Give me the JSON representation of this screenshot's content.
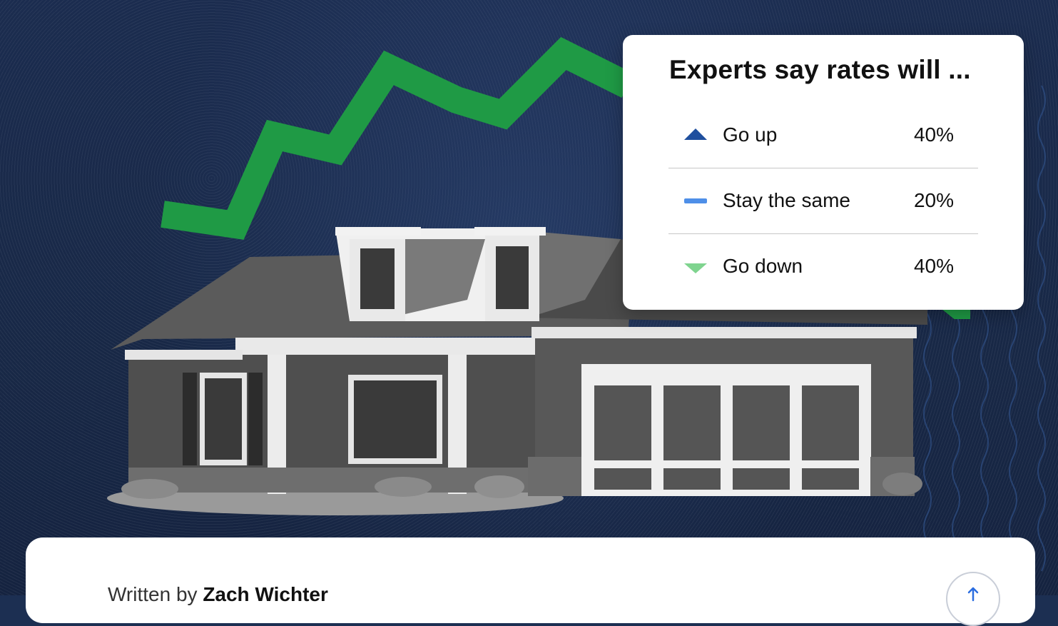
{
  "hero_image": {
    "description_icon": "house-photo-with-rising-chart"
  },
  "poll": {
    "title": "Experts say rates will ...",
    "options": [
      {
        "icon": "triangle-up-icon",
        "label": "Go up",
        "percent": "40%",
        "color": "#1f4f9e"
      },
      {
        "icon": "dash-icon",
        "label": "Stay the same",
        "percent": "20%",
        "color": "#4e8fe8"
      },
      {
        "icon": "triangle-down-icon",
        "label": "Go down",
        "percent": "40%",
        "color": "#7fd48f"
      }
    ]
  },
  "article": {
    "byline_prefix": "Written by",
    "author": "Zach Wichter"
  },
  "share": {
    "icon": "share-icon"
  },
  "colors": {
    "accent_green": "#1f9a45",
    "background_navy": "#1c2f52"
  }
}
